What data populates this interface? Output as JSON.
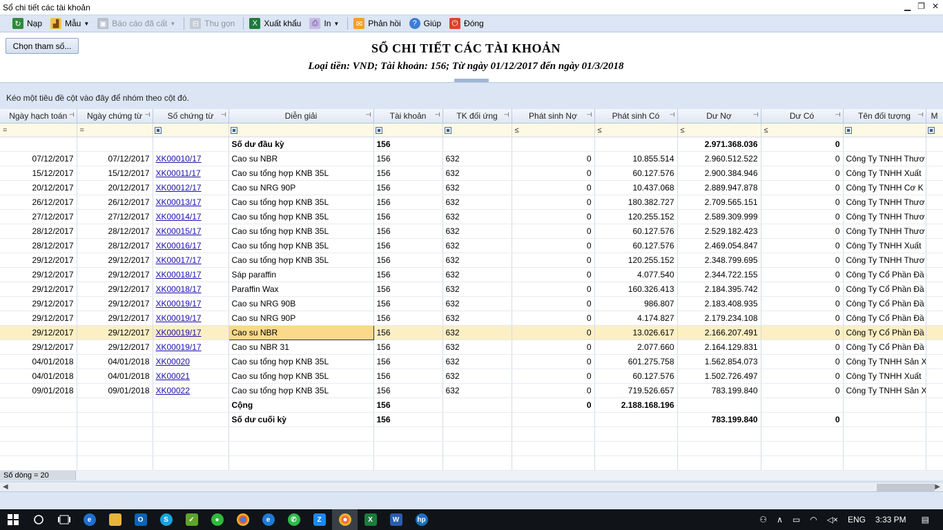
{
  "window": {
    "title": "Sổ chi tiết các tài khoản",
    "controls": [
      "▁",
      "❐",
      "✕"
    ]
  },
  "toolbar": {
    "reload": "Nạp",
    "template": "Mẫu",
    "saved_reports": "Báo cáo đã cất",
    "collapse": "Thu gọn",
    "export": "Xuất khẩu",
    "print": "In",
    "feedback": "Phản hồi",
    "help": "Giúp",
    "close": "Đóng"
  },
  "params_button": "Chọn tham số...",
  "report": {
    "title": "SỔ CHI TIẾT CÁC TÀI KHOẢN",
    "subtitle": "Loại tiền: VND; Tài khoản: 156; Từ ngày 01/12/2017 đến ngày 01/3/2018"
  },
  "group_panel": "Kéo một tiêu đề cột vào đây để nhóm theo cột đó.",
  "columns": [
    "Ngày hạch toán",
    "Ngày chứng từ",
    "Số chứng từ",
    "Diễn giải",
    "Tài khoản",
    "TK đối ứng",
    "Phát sinh Nợ",
    "Phát sinh Có",
    "Dư Nợ",
    "Dư Có",
    "Tên đối tượng",
    "M"
  ],
  "filter_ops": [
    "=",
    "=",
    "",
    "",
    "",
    "",
    "≤",
    "≤",
    "≤",
    "≤",
    "",
    ""
  ],
  "rows": [
    {
      "d1": "",
      "d2": "",
      "no": "",
      "desc": "Số dư đầu kỳ",
      "acc": "156",
      "contra": "",
      "debit": "",
      "credit": "",
      "bal_d": "2.971.368.036",
      "bal_c": "0",
      "party": "",
      "bold": true
    },
    {
      "d1": "07/12/2017",
      "d2": "07/12/2017",
      "no": "XK00010/17",
      "desc": "Cao su NBR",
      "acc": "156",
      "contra": "632",
      "debit": "0",
      "credit": "10.855.514",
      "bal_d": "2.960.512.522",
      "bal_c": "0",
      "party": "Công Ty TNHH Thươ"
    },
    {
      "d1": "15/12/2017",
      "d2": "15/12/2017",
      "no": "XK00011/17",
      "desc": "Cao su tổng hợp KNB 35L",
      "acc": "156",
      "contra": "632",
      "debit": "0",
      "credit": "60.127.576",
      "bal_d": "2.900.384.946",
      "bal_c": "0",
      "party": "Công Ty TNHH Xuất"
    },
    {
      "d1": "20/12/2017",
      "d2": "20/12/2017",
      "no": "XK00012/17",
      "desc": "Cao su NRG 90P",
      "acc": "156",
      "contra": "632",
      "debit": "0",
      "credit": "10.437.068",
      "bal_d": "2.889.947.878",
      "bal_c": "0",
      "party": "Công Ty TNHH Cơ K"
    },
    {
      "d1": "26/12/2017",
      "d2": "26/12/2017",
      "no": "XK00013/17",
      "desc": "Cao su tổng hợp KNB 35L",
      "acc": "156",
      "contra": "632",
      "debit": "0",
      "credit": "180.382.727",
      "bal_d": "2.709.565.151",
      "bal_c": "0",
      "party": "Công Ty TNHH Thươ"
    },
    {
      "d1": "27/12/2017",
      "d2": "27/12/2017",
      "no": "XK00014/17",
      "desc": "Cao su tổng hợp KNB 35L",
      "acc": "156",
      "contra": "632",
      "debit": "0",
      "credit": "120.255.152",
      "bal_d": "2.589.309.999",
      "bal_c": "0",
      "party": "Công Ty TNHH Thươ"
    },
    {
      "d1": "28/12/2017",
      "d2": "28/12/2017",
      "no": "XK00015/17",
      "desc": "Cao su tổng hợp KNB 35L",
      "acc": "156",
      "contra": "632",
      "debit": "0",
      "credit": "60.127.576",
      "bal_d": "2.529.182.423",
      "bal_c": "0",
      "party": "Công Ty TNHH Thươ"
    },
    {
      "d1": "28/12/2017",
      "d2": "28/12/2017",
      "no": "XK00016/17",
      "desc": "Cao su tổng hợp KNB 35L",
      "acc": "156",
      "contra": "632",
      "debit": "0",
      "credit": "60.127.576",
      "bal_d": "2.469.054.847",
      "bal_c": "0",
      "party": "Công Ty TNHH Xuất"
    },
    {
      "d1": "29/12/2017",
      "d2": "29/12/2017",
      "no": "XK00017/17",
      "desc": "Cao su tổng hợp KNB 35L",
      "acc": "156",
      "contra": "632",
      "debit": "0",
      "credit": "120.255.152",
      "bal_d": "2.348.799.695",
      "bal_c": "0",
      "party": "Công Ty TNHH Thươ"
    },
    {
      "d1": "29/12/2017",
      "d2": "29/12/2017",
      "no": "XK00018/17",
      "desc": "Sáp paraffin",
      "acc": "156",
      "contra": "632",
      "debit": "0",
      "credit": "4.077.540",
      "bal_d": "2.344.722.155",
      "bal_c": "0",
      "party": "Công Ty Cổ Phần Đầ"
    },
    {
      "d1": "29/12/2017",
      "d2": "29/12/2017",
      "no": "XK00018/17",
      "desc": "Paraffin Wax",
      "acc": "156",
      "contra": "632",
      "debit": "0",
      "credit": "160.326.413",
      "bal_d": "2.184.395.742",
      "bal_c": "0",
      "party": "Công Ty Cổ Phần Đầ"
    },
    {
      "d1": "29/12/2017",
      "d2": "29/12/2017",
      "no": "XK00019/17",
      "desc": "Cao su NRG 90B",
      "acc": "156",
      "contra": "632",
      "debit": "0",
      "credit": "986.807",
      "bal_d": "2.183.408.935",
      "bal_c": "0",
      "party": "Công Ty Cổ Phần Đầ"
    },
    {
      "d1": "29/12/2017",
      "d2": "29/12/2017",
      "no": "XK00019/17",
      "desc": "Cao su NRG 90P",
      "acc": "156",
      "contra": "632",
      "debit": "0",
      "credit": "4.174.827",
      "bal_d": "2.179.234.108",
      "bal_c": "0",
      "party": "Công Ty Cổ Phần Đầ"
    },
    {
      "d1": "29/12/2017",
      "d2": "29/12/2017",
      "no": "XK00019/17",
      "desc": "Cao su NBR",
      "acc": "156",
      "contra": "632",
      "debit": "0",
      "credit": "13.026.617",
      "bal_d": "2.166.207.491",
      "bal_c": "0",
      "party": "Công Ty Cổ Phần Đầ",
      "selected": true
    },
    {
      "d1": "29/12/2017",
      "d2": "29/12/2017",
      "no": "XK00019/17",
      "desc": "Cao su NBR 31",
      "acc": "156",
      "contra": "632",
      "debit": "0",
      "credit": "2.077.660",
      "bal_d": "2.164.129.831",
      "bal_c": "0",
      "party": "Công Ty Cổ Phần Đầ"
    },
    {
      "d1": "04/01/2018",
      "d2": "04/01/2018",
      "no": "XK00020",
      "desc": "Cao su tổng hợp KNB 35L",
      "acc": "156",
      "contra": "632",
      "debit": "0",
      "credit": "601.275.758",
      "bal_d": "1.562.854.073",
      "bal_c": "0",
      "party": "Công Ty TNHH Sản X"
    },
    {
      "d1": "04/01/2018",
      "d2": "04/01/2018",
      "no": "XK00021",
      "desc": "Cao su tổng hợp KNB 35L",
      "acc": "156",
      "contra": "632",
      "debit": "0",
      "credit": "60.127.576",
      "bal_d": "1.502.726.497",
      "bal_c": "0",
      "party": "Công Ty TNHH Xuất"
    },
    {
      "d1": "09/01/2018",
      "d2": "09/01/2018",
      "no": "XK00022",
      "desc": "Cao su tổng hợp KNB 35L",
      "acc": "156",
      "contra": "632",
      "debit": "0",
      "credit": "719.526.657",
      "bal_d": "783.199.840",
      "bal_c": "0",
      "party": "Công Ty TNHH Sản X"
    },
    {
      "d1": "",
      "d2": "",
      "no": "",
      "desc": "Cộng",
      "acc": "156",
      "contra": "",
      "debit": "0",
      "credit": "2.188.168.196",
      "bal_d": "",
      "bal_c": "",
      "party": "",
      "bold": true
    },
    {
      "d1": "",
      "d2": "",
      "no": "",
      "desc": "Số dư cuối kỳ",
      "acc": "156",
      "contra": "",
      "debit": "",
      "credit": "",
      "bal_d": "783.199.840",
      "bal_c": "0",
      "party": "",
      "bold": true
    }
  ],
  "status": "Số dòng = 20",
  "taskbar": {
    "apps": [
      "start-icon",
      "search-icon",
      "task-view-icon",
      "edge-icon",
      "file-explorer-icon",
      "outlook-icon",
      "skype-icon",
      "app-green-icon",
      "wechat-icon",
      "chrome-icon",
      "ie-icon",
      "whatsapp-icon",
      "zalo-icon",
      "misa-icon",
      "excel-icon",
      "word-icon",
      "hp-icon"
    ],
    "lang": "ENG",
    "time": "3:33 PM"
  }
}
